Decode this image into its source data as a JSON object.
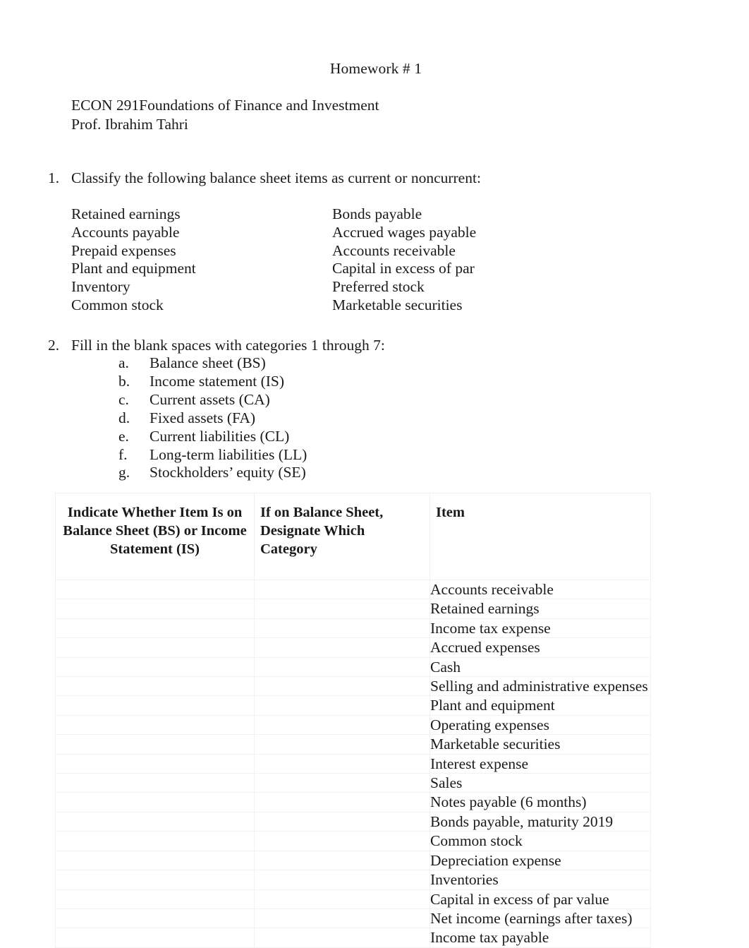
{
  "document": {
    "title": "Homework # 1",
    "course_line": "ECON 291Foundations of Finance and Investment",
    "instructor_line": "Prof. Ibrahim Tahri"
  },
  "question1": {
    "marker": "1.",
    "prompt": "Classify the following balance sheet items as current or noncurrent:",
    "column_left": [
      "Retained earnings",
      "Accounts payable",
      "Prepaid expenses",
      "Plant and equipment",
      "Inventory",
      "Common stock"
    ],
    "column_right": [
      "Bonds payable",
      "Accrued wages payable",
      "Accounts receivable",
      "Capital in excess of par",
      "Preferred stock",
      "Marketable securities"
    ]
  },
  "question2": {
    "marker": "2.",
    "prompt": "Fill in the blank spaces with categories 1 through 7:",
    "categories": [
      {
        "marker": "a.",
        "label": "Balance sheet (BS)"
      },
      {
        "marker": "b.",
        "label": "Income statement (IS)"
      },
      {
        "marker": "c.",
        "label": "Current assets (CA)"
      },
      {
        "marker": "d.",
        "label": "Fixed assets (FA)"
      },
      {
        "marker": "e.",
        "label": "Current liabilities (CL)"
      },
      {
        "marker": "f.",
        "label": "Long-term liabilities (LL)"
      },
      {
        "marker": "g.",
        "label": "Stockholders’ equity (SE)"
      }
    ],
    "table": {
      "headers": [
        "Indicate Whether Item Is on Balance Sheet (BS) or Income Statement (IS)",
        "If on Balance Sheet, Designate Which Category",
        "Item"
      ],
      "rows": [
        {
          "bs_or_is": "",
          "category": "",
          "item": "Accounts receivable"
        },
        {
          "bs_or_is": "",
          "category": "",
          "item": "Retained earnings"
        },
        {
          "bs_or_is": "",
          "category": "",
          "item": "Income tax expense"
        },
        {
          "bs_or_is": "",
          "category": "",
          "item": "Accrued expenses"
        },
        {
          "bs_or_is": "",
          "category": "",
          "item": "Cash"
        },
        {
          "bs_or_is": "",
          "category": "",
          "item": "Selling and administrative expenses"
        },
        {
          "bs_or_is": "",
          "category": "",
          "item": "Plant and equipment"
        },
        {
          "bs_or_is": "",
          "category": "",
          "item": "Operating expenses"
        },
        {
          "bs_or_is": "",
          "category": "",
          "item": "Marketable securities"
        },
        {
          "bs_or_is": "",
          "category": "",
          "item": "Interest expense"
        },
        {
          "bs_or_is": "",
          "category": "",
          "item": "Sales"
        },
        {
          "bs_or_is": "",
          "category": "",
          "item": "Notes payable (6 months)"
        },
        {
          "bs_or_is": "",
          "category": "",
          "item": "Bonds payable, maturity 2019"
        },
        {
          "bs_or_is": "",
          "category": "",
          "item": "Common stock"
        },
        {
          "bs_or_is": "",
          "category": "",
          "item": "Depreciation expense"
        },
        {
          "bs_or_is": "",
          "category": "",
          "item": "Inventories"
        },
        {
          "bs_or_is": "",
          "category": "",
          "item": "Capital in excess of par value"
        },
        {
          "bs_or_is": "",
          "category": "",
          "item": "Net income (earnings after taxes)"
        },
        {
          "bs_or_is": "",
          "category": "",
          "item": "Income tax payable"
        }
      ]
    }
  },
  "style": {
    "page_background": "#ffffff",
    "text_color": "#1a1a1a",
    "table_border_color": "#efefef"
  }
}
